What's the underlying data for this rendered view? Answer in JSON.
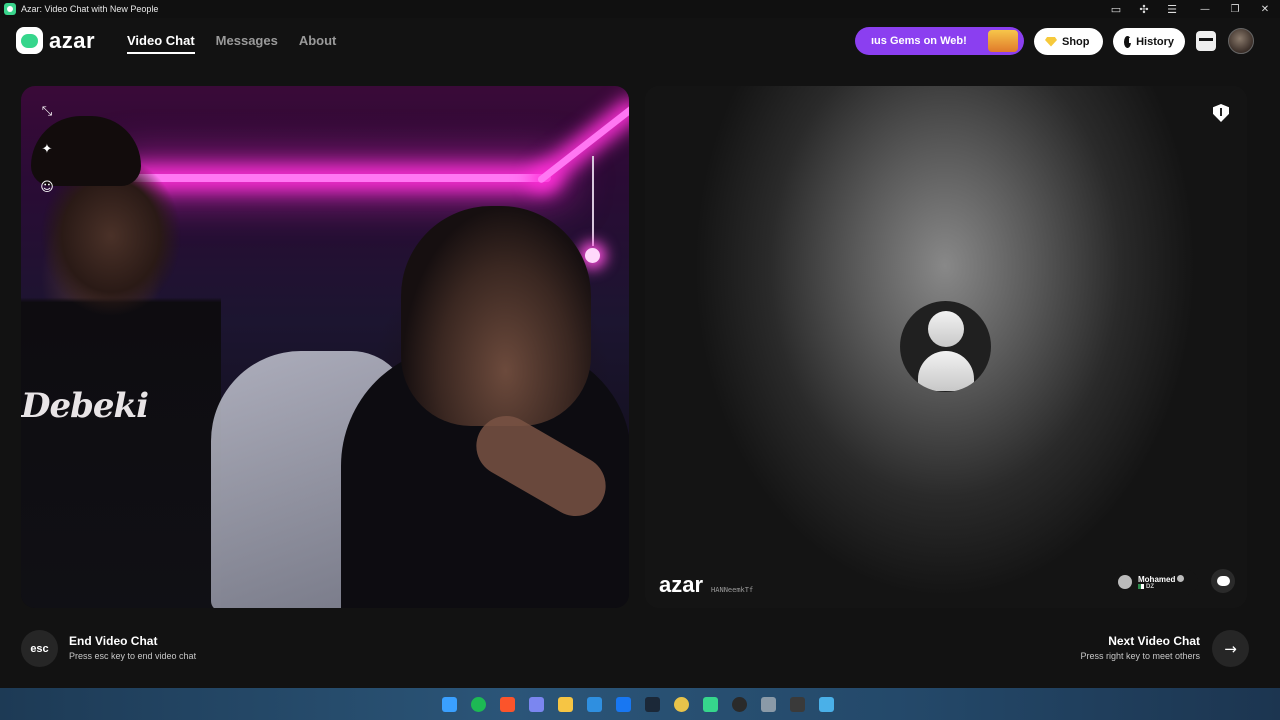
{
  "window": {
    "title": "Azar: Video Chat with New People",
    "controls": [
      "—",
      "❐",
      "✕"
    ],
    "extras": [
      "video-icon",
      "puzzle-icon",
      "menu-icon"
    ]
  },
  "nav": {
    "logo_text": "azar",
    "links": [
      {
        "label": "Video Chat",
        "active": true
      },
      {
        "label": "Messages",
        "active": false
      },
      {
        "label": "About",
        "active": false
      }
    ],
    "promo_text": "ıus Gems on Web!",
    "shop_label": "Shop",
    "history_label": "History"
  },
  "remote": {
    "brand": "azar",
    "session_id": "HANNeemkTf",
    "user_name": "Mohamed",
    "country_code": "DZ"
  },
  "controls": {
    "esc_key": "esc",
    "end_title": "End Video Chat",
    "end_subtitle": "Press esc key to end video chat",
    "next_title": "Next Video Chat",
    "next_subtitle": "Press right key to meet others",
    "next_arrow": "→"
  },
  "local_panel": {
    "shirt_text": "Debeki"
  },
  "taskbar": {
    "icons": [
      {
        "name": "windows-icon",
        "color": "#3aa0ff"
      },
      {
        "name": "spotify-icon",
        "color": "#1db954"
      },
      {
        "name": "brave-icon",
        "color": "#fb542b"
      },
      {
        "name": "discord-icon",
        "color": "#7b86f0"
      },
      {
        "name": "folder-icon",
        "color": "#f6c544"
      },
      {
        "name": "vscode-icon",
        "color": "#2f8fe0"
      },
      {
        "name": "facebook-icon",
        "color": "#1877f2"
      },
      {
        "name": "steam-icon",
        "color": "#1b2838"
      },
      {
        "name": "chrome-icon",
        "color": "#e8c34a"
      },
      {
        "name": "azar-icon",
        "color": "#36d68c"
      },
      {
        "name": "obs-icon",
        "color": "#2a2a2a"
      },
      {
        "name": "settings-icon",
        "color": "#8a9aa8"
      },
      {
        "name": "media-player-icon",
        "color": "#3a3a3a"
      },
      {
        "name": "remote-desktop-icon",
        "color": "#4ab0e8"
      }
    ]
  }
}
